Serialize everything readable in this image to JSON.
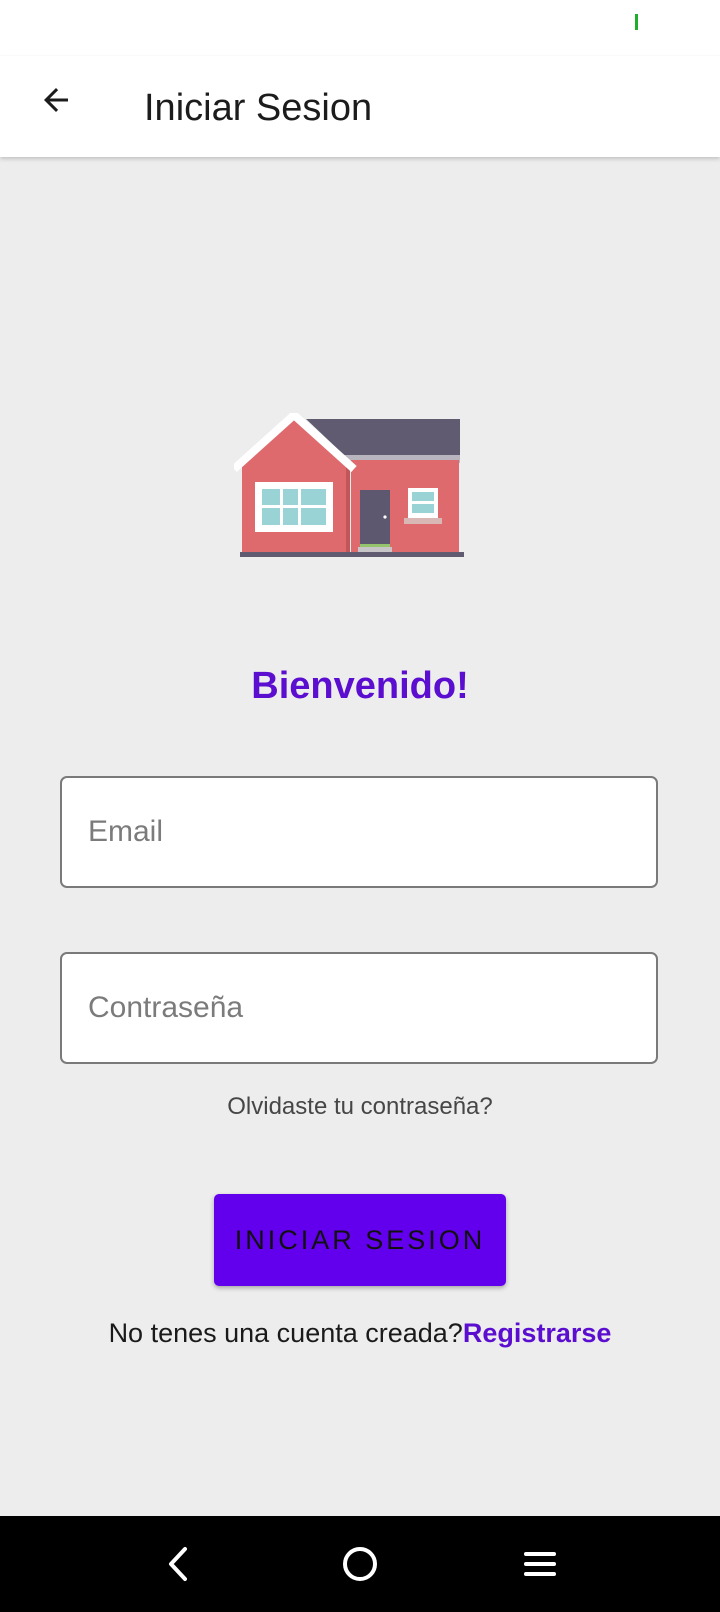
{
  "app_bar": {
    "title": "Iniciar Sesion",
    "back_icon": "arrow-back-icon"
  },
  "hero": {
    "illustration": "house-icon",
    "welcome": "Bienvenido!"
  },
  "form": {
    "email_placeholder": "Email",
    "password_placeholder": "Contraseña",
    "forgot_password": "Olvidaste tu contraseña?",
    "login_button": "INICIAR SESION",
    "signup_prompt": "No tenes una cuenta creada?",
    "signup_link": "Registrarse"
  },
  "system_nav": {
    "back_icon": "nav-back-icon",
    "home_icon": "nav-home-icon",
    "menu_icon": "nav-menu-icon"
  },
  "colors": {
    "accent": "#6200ee",
    "accent_text": "#5b0ed0",
    "background": "#ededed"
  }
}
